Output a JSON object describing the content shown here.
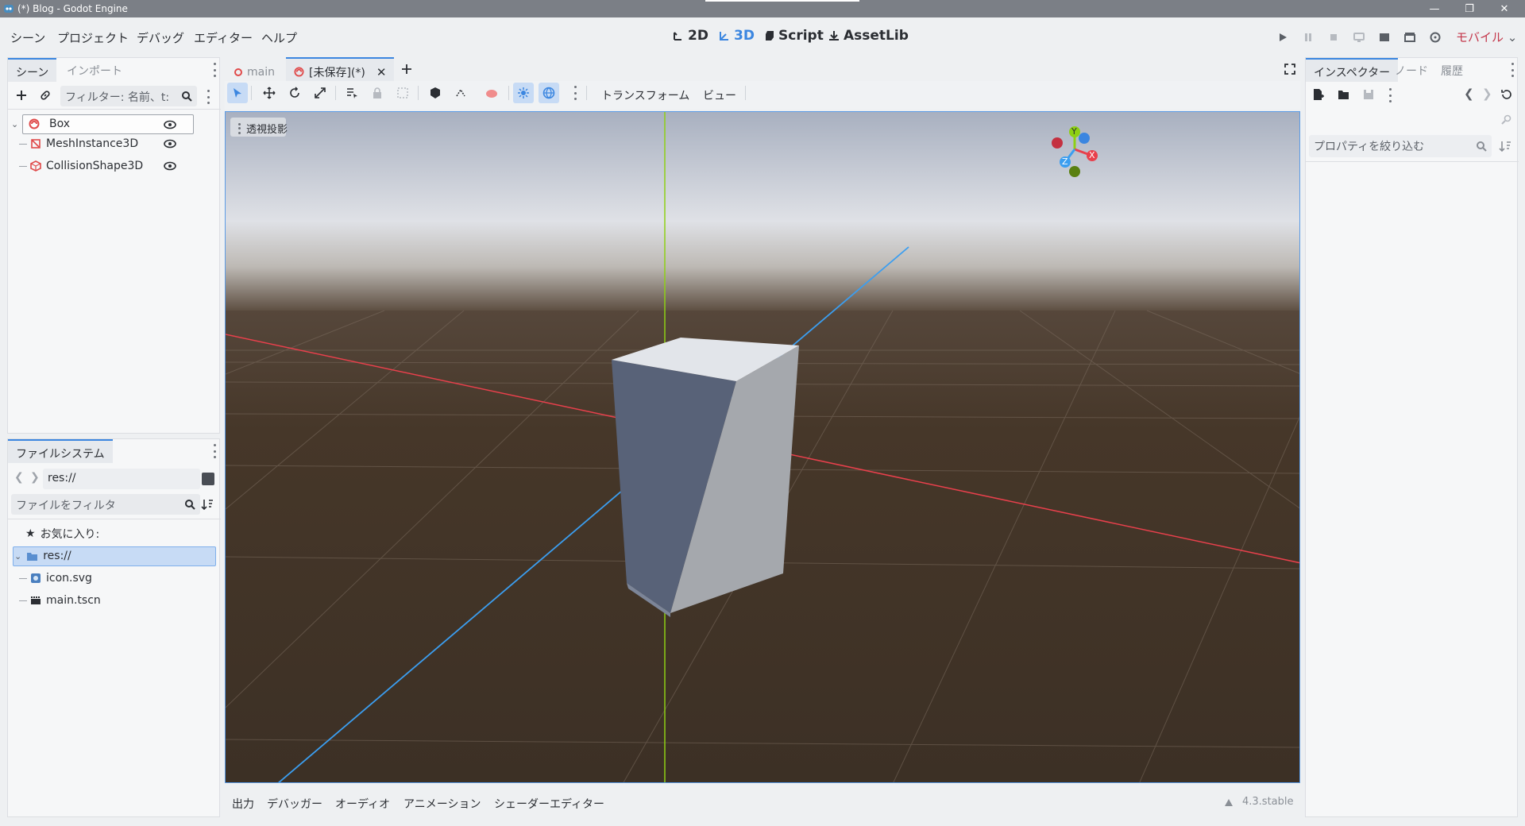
{
  "window": {
    "title": "(*) Blog - Godot Engine"
  },
  "menu": [
    "シーン",
    "プロジェクト",
    "デバッグ",
    "エディター",
    "ヘルプ"
  ],
  "workspaces": [
    {
      "label": "2D",
      "icon": "2d-icon"
    },
    {
      "label": "3D",
      "icon": "3d-icon",
      "active": true
    },
    {
      "label": "Script",
      "icon": "script-icon"
    },
    {
      "label": "AssetLib",
      "icon": "assetlib-icon"
    }
  ],
  "renderer": "モバイル",
  "scene_dock": {
    "tabs": [
      "シーン",
      "インポート"
    ],
    "filter_placeholder": "フィルター: 名前、t:",
    "tree": [
      {
        "label": "Box",
        "icon": "rigidbody-icon",
        "depth": 0
      },
      {
        "label": "MeshInstance3D",
        "icon": "mesh-icon",
        "depth": 1
      },
      {
        "label": "CollisionShape3D",
        "icon": "collision-icon",
        "depth": 1
      }
    ]
  },
  "filesystem": {
    "tab": "ファイルシステム",
    "path": "res://",
    "filter_placeholder": "ファイルをフィルタ",
    "favorites": "お気に入り:",
    "root": "res://",
    "files": [
      {
        "label": "icon.svg",
        "icon": "image-file-icon"
      },
      {
        "label": "main.tscn",
        "icon": "scene-file-icon"
      }
    ]
  },
  "scene_tabs": [
    {
      "label": "main"
    },
    {
      "label": "[未保存](*)",
      "active": true
    }
  ],
  "viewport_toolbar": {
    "transform": "トランスフォーム",
    "view": "ビュー"
  },
  "viewport": {
    "projection": "透視投影",
    "gizmo": {
      "x": "X",
      "y": "Y",
      "z": "Z"
    }
  },
  "bottom": {
    "tabs": [
      "出力",
      "デバッガー",
      "オーディオ",
      "アニメーション",
      "シェーダーエディター"
    ],
    "version": "4.3.stable"
  },
  "inspector": {
    "tabs": [
      "インスペクター",
      "ノード",
      "履歴"
    ],
    "filter_placeholder": "プロパティを絞り込む"
  },
  "colors": {
    "accent": "#3b86e0",
    "x_axis": "#e8404c",
    "y_axis": "#8ed014",
    "z_axis": "#3b9ef0",
    "renderer": "#c4384c"
  }
}
